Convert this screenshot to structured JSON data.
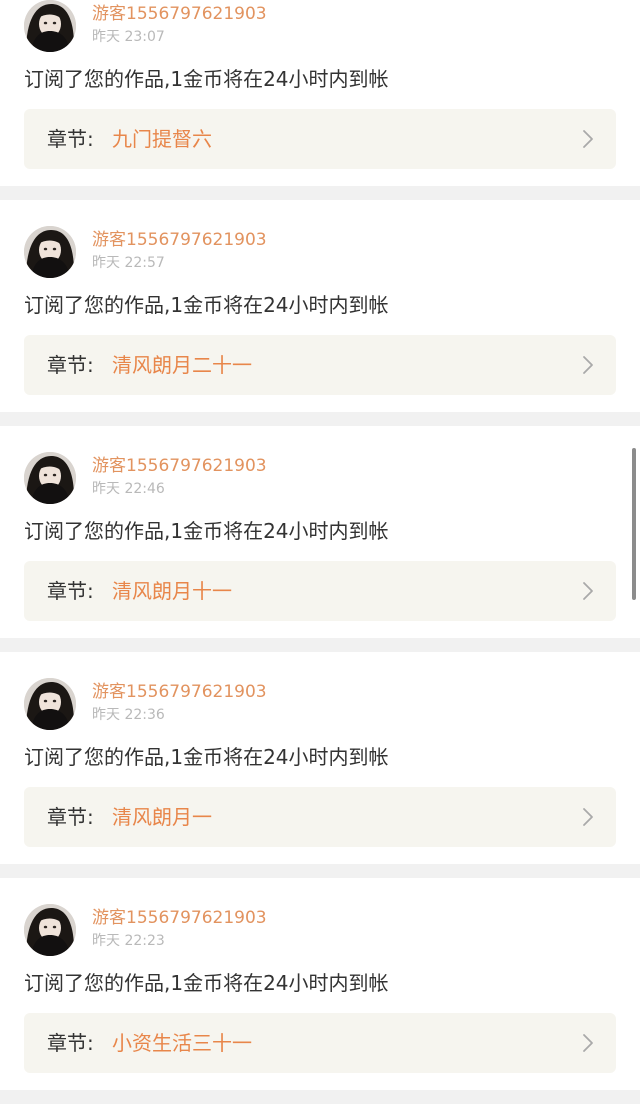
{
  "notifications": [
    {
      "username": "游客1556797621903",
      "time": "昨天 23:07",
      "message": "订阅了您的作品,1金币将在24小时内到帐",
      "chapter_label": "章节:",
      "chapter_title": "九门提督六"
    },
    {
      "username": "游客1556797621903",
      "time": "昨天 22:57",
      "message": "订阅了您的作品,1金币将在24小时内到帐",
      "chapter_label": "章节:",
      "chapter_title": "清风朗月二十一"
    },
    {
      "username": "游客1556797621903",
      "time": "昨天 22:46",
      "message": "订阅了您的作品,1金币将在24小时内到帐",
      "chapter_label": "章节:",
      "chapter_title": "清风朗月十一"
    },
    {
      "username": "游客1556797621903",
      "time": "昨天 22:36",
      "message": "订阅了您的作品,1金币将在24小时内到帐",
      "chapter_label": "章节:",
      "chapter_title": "清风朗月一"
    },
    {
      "username": "游客1556797621903",
      "time": "昨天 22:23",
      "message": "订阅了您的作品,1金币将在24小时内到帐",
      "chapter_label": "章节:",
      "chapter_title": "小资生活三十一"
    }
  ],
  "icons": {
    "avatar": "avatar-photo",
    "chevron": "chevron-right-icon"
  },
  "colors": {
    "username": "#e2935f",
    "chapter_title": "#e8864a",
    "time": "#b9b9b9",
    "chapter_bar_bg": "#f6f5ef",
    "page_bg": "#f1f1f1"
  }
}
